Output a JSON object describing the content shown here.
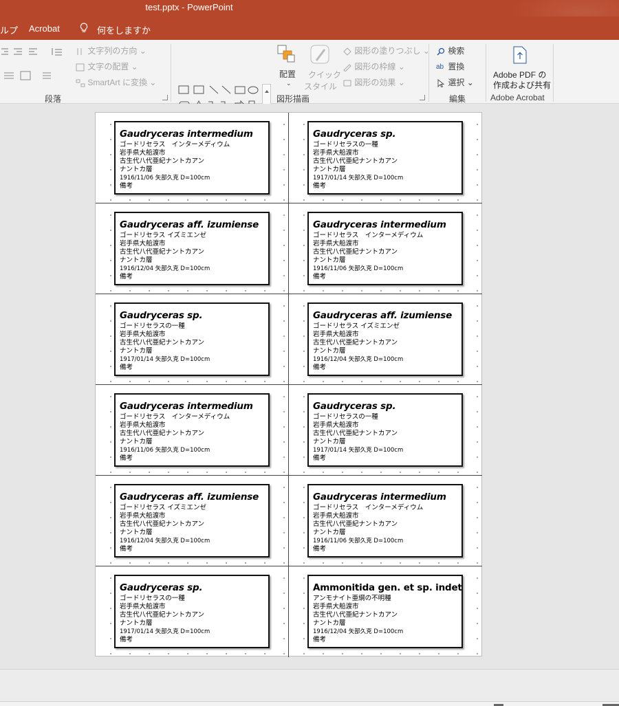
{
  "window": {
    "title": "test.pptx  -  PowerPoint"
  },
  "menu": {
    "help_partial": "ルプ",
    "acrobat": "Acrobat",
    "tell_me": "何をしますか"
  },
  "ribbon": {
    "paragraph": {
      "label": "段落",
      "text_direction": "文字列の方向",
      "align_text": "文字の配置",
      "smartart": "SmartArt に変換"
    },
    "drawing": {
      "label": "図形描画",
      "arrange": "配置",
      "quick_styles_line1": "クイック",
      "quick_styles_line2": "スタイル",
      "shape_fill": "図形の塗りつぶし",
      "shape_outline": "図形の枠線",
      "shape_effects": "図形の効果"
    },
    "editing": {
      "label": "編集",
      "find": "検索",
      "replace": "置換",
      "select": "選択"
    },
    "acrobat": {
      "label": "Adobe Acrobat",
      "create_line1": "Adobe PDF の",
      "create_line2": "作成および共有"
    }
  },
  "colors": {
    "accent": "#b7472a",
    "ribbon_bg": "#f3f3f3",
    "workspace": "#e6e6e6"
  },
  "cards": [
    {
      "name": "Gaudryceras intermedium",
      "italic": true,
      "kana": "ゴードリセラス　インターメディウム",
      "pref": "岩手県大船渡市",
      "era": "古生代八代亜紀ナントカアン",
      "layer": "ナントカ層",
      "record": "1916/11/06  矢部久克  D=100cm",
      "note": "備考"
    },
    {
      "name": "Gaudryceras sp.",
      "italic": true,
      "kana": "ゴードリセラスの一種",
      "pref": "岩手県大船渡市",
      "era": "古生代八代亜紀ナントカアン",
      "layer": "ナントカ層",
      "record": "1917/01/14  矢部久克  D=100cm",
      "note": "備考"
    },
    {
      "name": "Gaudryceras aff. izumiense",
      "italic": true,
      "kana": "ゴードリセラス イズミエンゼ",
      "pref": "岩手県大船渡市",
      "era": "古生代八代亜紀ナントカアン",
      "layer": "ナントカ層",
      "record": "1916/12/04  矢部久克  D=100cm",
      "note": "備考"
    },
    {
      "name": "Gaudryceras intermedium",
      "italic": true,
      "kana": "ゴードリセラス　インターメディウム",
      "pref": "岩手県大船渡市",
      "era": "古生代八代亜紀ナントカアン",
      "layer": "ナントカ層",
      "record": "1916/11/06  矢部久克  D=100cm",
      "note": "備考"
    },
    {
      "name": "Gaudryceras sp.",
      "italic": true,
      "kana": "ゴードリセラスの一種",
      "pref": "岩手県大船渡市",
      "era": "古生代八代亜紀ナントカアン",
      "layer": "ナントカ層",
      "record": "1917/01/14  矢部久克  D=100cm",
      "note": "備考"
    },
    {
      "name": "Gaudryceras aff. izumiense",
      "italic": true,
      "kana": "ゴードリセラス イズミエンゼ",
      "pref": "岩手県大船渡市",
      "era": "古生代八代亜紀ナントカアン",
      "layer": "ナントカ層",
      "record": "1916/12/04  矢部久克  D=100cm",
      "note": "備考"
    },
    {
      "name": "Gaudryceras intermedium",
      "italic": true,
      "kana": "ゴードリセラス　インターメディウム",
      "pref": "岩手県大船渡市",
      "era": "古生代八代亜紀ナントカアン",
      "layer": "ナントカ層",
      "record": "1916/11/06  矢部久克  D=100cm",
      "note": "備考"
    },
    {
      "name": "Gaudryceras sp.",
      "italic": true,
      "kana": "ゴードリセラスの一種",
      "pref": "岩手県大船渡市",
      "era": "古生代八代亜紀ナントカアン",
      "layer": "ナントカ層",
      "record": "1917/01/14  矢部久克  D=100cm",
      "note": "備考"
    },
    {
      "name": "Gaudryceras aff. izumiense",
      "italic": true,
      "kana": "ゴードリセラス イズミエンゼ",
      "pref": "岩手県大船渡市",
      "era": "古生代八代亜紀ナントカアン",
      "layer": "ナントカ層",
      "record": "1916/12/04  矢部久克  D=100cm",
      "note": "備考"
    },
    {
      "name": "Gaudryceras intermedium",
      "italic": true,
      "kana": "ゴードリセラス　インターメディウム",
      "pref": "岩手県大船渡市",
      "era": "古生代八代亜紀ナントカアン",
      "layer": "ナントカ層",
      "record": "1916/11/06  矢部久克  D=100cm",
      "note": "備考"
    },
    {
      "name": "Gaudryceras sp.",
      "italic": true,
      "kana": "ゴードリセラスの一種",
      "pref": "岩手県大船渡市",
      "era": "古生代八代亜紀ナントカアン",
      "layer": "ナントカ層",
      "record": "1917/01/14  矢部久克  D=100cm",
      "note": "備考"
    },
    {
      "name": "Ammonitida gen. et sp. indet",
      "italic": false,
      "kana": "アンモナイト亜綱の不明種",
      "pref": "岩手県大船渡市",
      "era": "古生代八代亜紀ナントカアン",
      "layer": "ナントカ層",
      "record": "1916/12/04  矢部久克  D=100cm",
      "note": "備考"
    }
  ]
}
